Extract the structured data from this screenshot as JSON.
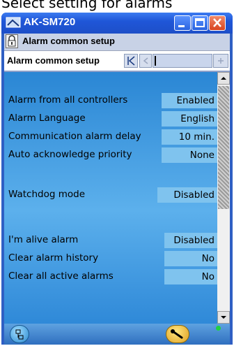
{
  "caption": "Select setting for alarms",
  "window": {
    "title": "AK-SM720",
    "controls": {
      "minimize_icon": "minimize-icon",
      "maximize_icon": "maximize-icon",
      "close_icon": "close-icon"
    }
  },
  "header": {
    "lock_icon": "lock-icon",
    "title": "Alarm common setup",
    "subtitle": "Alarm common setup",
    "nav": {
      "first_icon": "first-page-icon",
      "prev_icon": "previous-icon",
      "next_icon": "next-icon"
    }
  },
  "rows": [
    {
      "label": "Alarm from all controllers",
      "value": "Enabled"
    },
    {
      "label": "Alarm Language",
      "value": "English"
    },
    {
      "label": "Communication alarm delay",
      "value": "10 min."
    },
    {
      "label": "Auto acknowledge priority",
      "value": "None"
    },
    {
      "label": "Watchdog mode",
      "value": "Disabled"
    },
    {
      "label": "I'm alive alarm",
      "value": "Disabled"
    },
    {
      "label": "Clear alarm history",
      "value": "No"
    },
    {
      "label": "Clear all active alarms",
      "value": "No"
    }
  ],
  "footer": {
    "left_icon": "network-icon",
    "right_icon": "wrench-icon",
    "status_icon": "status-led-icon"
  },
  "colors": {
    "titlebar": "#1f56d8",
    "list_bg": "#4aa3e6",
    "value_bg": "#7fc3ee",
    "close": "#d84420"
  }
}
